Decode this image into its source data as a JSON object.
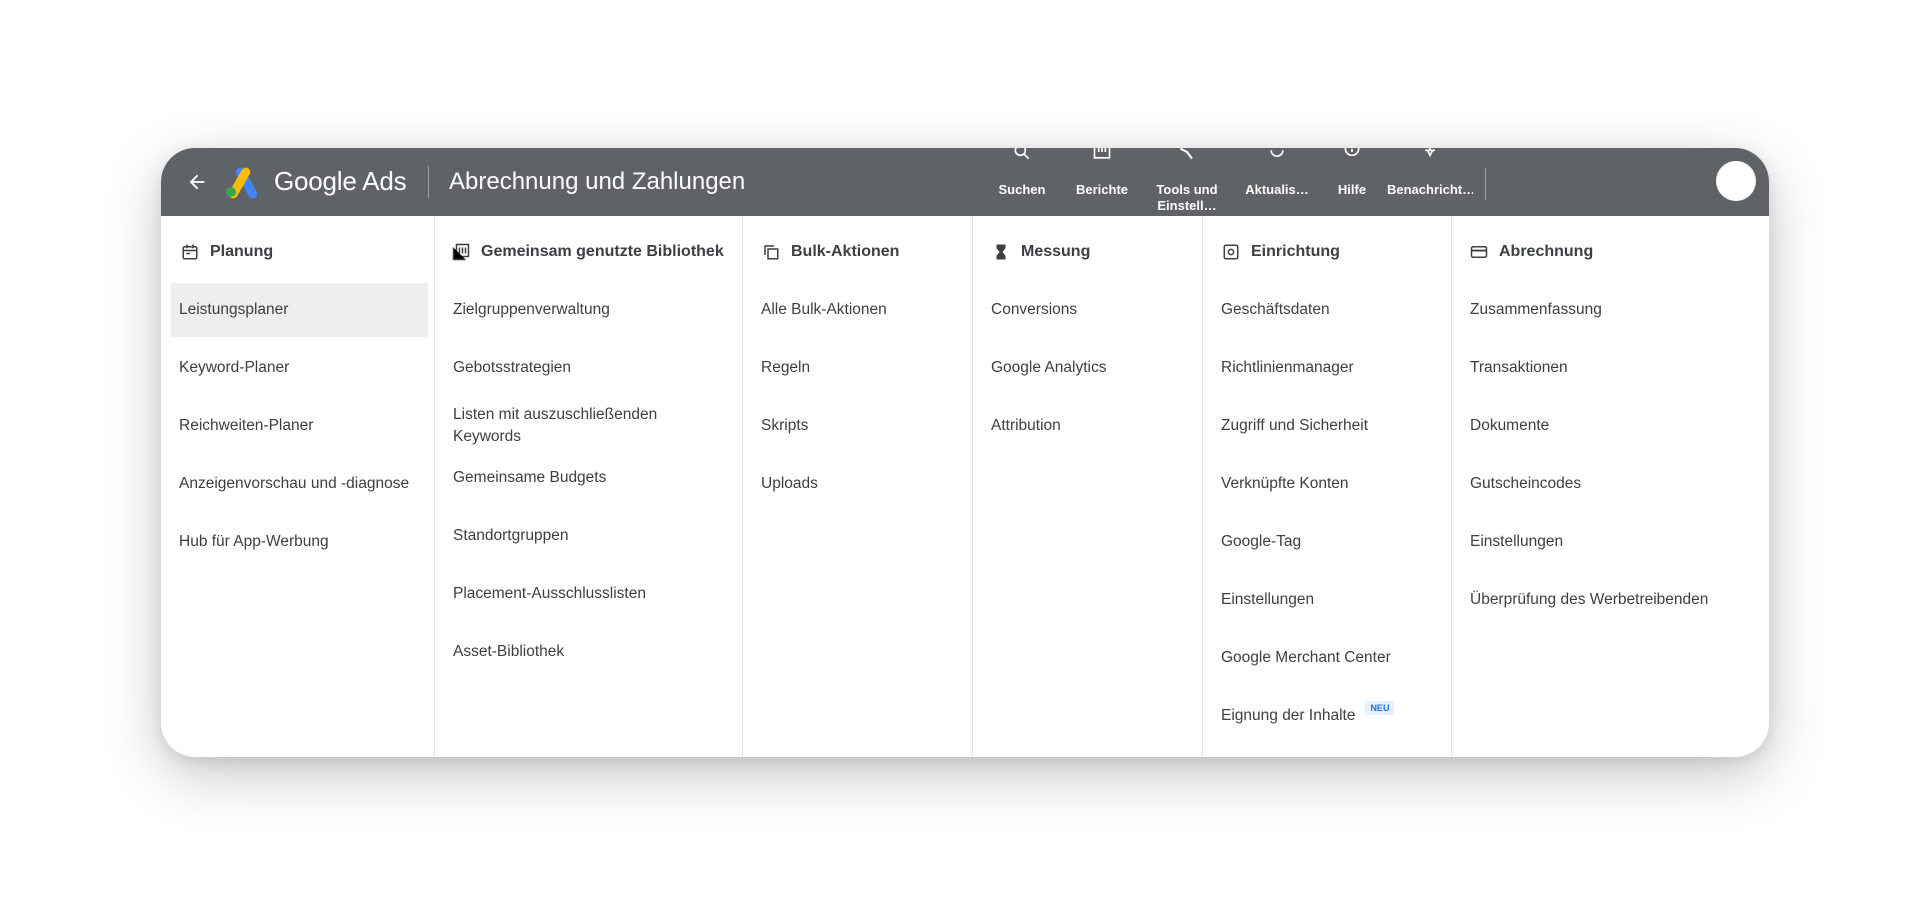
{
  "header": {
    "brand": "Google Ads",
    "page_title": "Abrechnung und Zahlungen",
    "tools": [
      {
        "label": "Suchen",
        "icon": "search-icon"
      },
      {
        "label": "Berichte",
        "icon": "reports-icon"
      },
      {
        "label": "Tools und Einstell…",
        "icon": "wrench-icon"
      },
      {
        "label": "Aktualis…",
        "icon": "refresh-icon"
      },
      {
        "label": "Hilfe",
        "icon": "help-icon"
      },
      {
        "label": "Benachricht…",
        "icon": "bell-icon"
      }
    ]
  },
  "menu": {
    "columns": [
      {
        "heading": "Planung",
        "icon": "calendar-icon",
        "items": [
          "Leistungsplaner",
          "Keyword-Planer",
          "Reichweiten-Planer",
          "Anzeigenvorschau und -diagnose",
          "Hub für App-Werbung"
        ]
      },
      {
        "heading": "Gemeinsam genutzte Bibliothek",
        "icon": "library-icon",
        "items": [
          "Zielgruppenverwaltung",
          "Gebotsstrategien",
          "Listen mit auszuschließenden Keywords",
          "Gemeinsame Budgets",
          "Standortgruppen",
          "Placement-Ausschlusslisten",
          "Asset-Bibliothek"
        ]
      },
      {
        "heading": "Bulk-Aktionen",
        "icon": "copy-icon",
        "items": [
          "Alle Bulk-Aktionen",
          "Regeln",
          "Skripts",
          "Uploads"
        ]
      },
      {
        "heading": "Messung",
        "icon": "hourglass-icon",
        "items": [
          "Conversions",
          "Google Analytics",
          "Attribution"
        ]
      },
      {
        "heading": "Einrichtung",
        "icon": "settings-box-icon",
        "items": [
          "Geschäftsdaten",
          "Richtlinienmanager",
          "Zugriff und Sicherheit",
          "Verknüpfte Konten",
          "Google-Tag",
          "Einstellungen",
          "Google Merchant Center",
          "Eignung der Inhalte"
        ],
        "badge": "NEU"
      },
      {
        "heading": "Abrechnung",
        "icon": "credit-card-icon",
        "items": [
          "Zusammenfassung",
          "Transaktionen",
          "Dokumente",
          "Gutscheincodes",
          "Einstellungen",
          "Überprüfung des Werbetreibenden"
        ]
      }
    ]
  },
  "colors": {
    "topbar": "#5f6368",
    "active_row": "#eeeeee",
    "text": "#3c4043",
    "badge_text": "#1a73e8",
    "badge_bg": "#e8f0fe",
    "logo_blue": "#4285F4",
    "logo_yellow": "#FBBC04",
    "logo_green": "#34A853"
  }
}
